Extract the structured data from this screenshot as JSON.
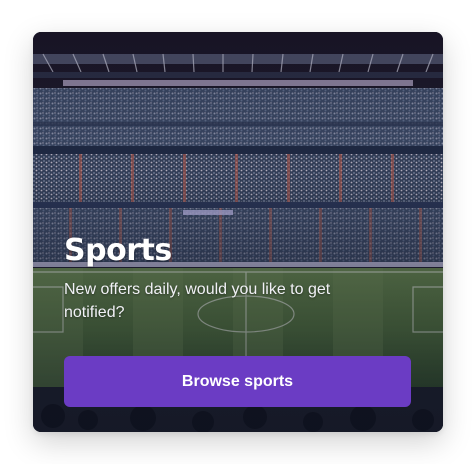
{
  "card": {
    "title": "Sports",
    "subtitle": "New offers daily, would you like to get notified?",
    "button_label": "Browse sports",
    "accent_color": "#6b3cc4",
    "background_image": "stadium-photo"
  }
}
